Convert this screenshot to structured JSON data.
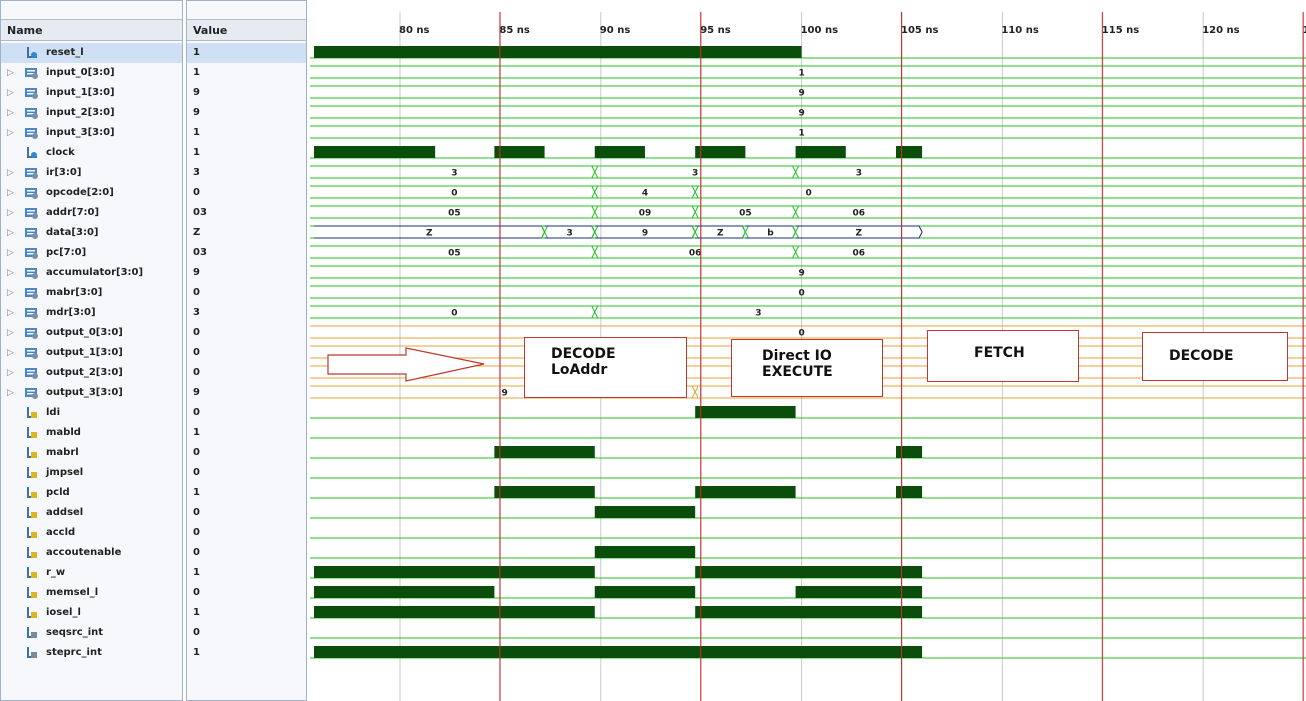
{
  "headers": {
    "name": "Name",
    "value": "Value"
  },
  "time_labels": [
    "80 ns",
    "85 ns",
    "90 ns",
    "95 ns",
    "100 ns",
    "105 ns",
    "110 ns",
    "115 ns",
    "120 ns",
    "1"
  ],
  "colors": {
    "wave": "#22c322",
    "fill": "#0b4d0b",
    "bus_orange": "#e4a33a",
    "cursor": "#d42a2a",
    "grid": "#c9c9c9",
    "bus_outline": "#1b2d7a"
  },
  "signals": [
    {
      "name": "reset_l",
      "value": "1",
      "kind": "bit",
      "icon": "input-pin-icon",
      "selected": true,
      "wave": [
        [
          0,
          4,
          1
        ]
      ]
    },
    {
      "name": "input_0[3:0]",
      "value": "1",
      "kind": "bus",
      "icon": "bus-icon",
      "expandable": true,
      "wave": [
        [
          0,
          4,
          "1"
        ]
      ]
    },
    {
      "name": "input_1[3:0]",
      "value": "9",
      "kind": "bus",
      "icon": "bus-icon",
      "expandable": true,
      "wave": [
        [
          0,
          4,
          "9"
        ]
      ]
    },
    {
      "name": "input_2[3:0]",
      "value": "9",
      "kind": "bus",
      "icon": "bus-icon",
      "expandable": true,
      "wave": [
        [
          0,
          4,
          "9"
        ]
      ]
    },
    {
      "name": "input_3[3:0]",
      "value": "1",
      "kind": "bus",
      "icon": "bus-icon",
      "expandable": true,
      "wave": [
        [
          0,
          4,
          "1"
        ]
      ]
    },
    {
      "name": "clock",
      "value": "1",
      "kind": "bit",
      "icon": "input-pin-icon",
      "wave": [
        [
          0,
          0.35,
          1
        ],
        [
          0.35,
          0.94,
          0
        ],
        [
          0.94,
          1.44,
          1
        ],
        [
          1.44,
          1.94,
          0
        ],
        [
          1.94,
          2.44,
          1
        ],
        [
          2.44,
          2.94,
          0
        ],
        [
          2.94,
          3.44,
          1
        ],
        [
          3.44,
          3.94,
          0
        ],
        [
          3.94,
          4.44,
          1
        ],
        [
          4.44,
          4.94,
          0
        ],
        [
          4.94,
          5.2,
          1
        ]
      ]
    },
    {
      "name": "ir[3:0]",
      "value": "3",
      "kind": "bus",
      "icon": "bus-icon",
      "expandable": true,
      "wave": [
        [
          0,
          1.94,
          "3"
        ],
        [
          1.94,
          3.94,
          "3"
        ],
        [
          3.94,
          5.2,
          "3"
        ]
      ]
    },
    {
      "name": "opcode[2:0]",
      "value": "0",
      "kind": "bus",
      "icon": "bus-icon",
      "expandable": true,
      "wave": [
        [
          0,
          1.94,
          "0"
        ],
        [
          1.94,
          2.94,
          "4"
        ],
        [
          2.94,
          5.2,
          "0"
        ]
      ]
    },
    {
      "name": "addr[7:0]",
      "value": "03",
      "kind": "bus",
      "icon": "bus-icon",
      "expandable": true,
      "wave": [
        [
          0,
          1.94,
          "05"
        ],
        [
          1.94,
          2.94,
          "09"
        ],
        [
          2.94,
          3.94,
          "05"
        ],
        [
          3.94,
          5.2,
          "06"
        ]
      ]
    },
    {
      "name": "data[3:0]",
      "value": "Z",
      "kind": "bus",
      "icon": "bus-icon",
      "expandable": true,
      "outlined": true,
      "wave": [
        [
          0,
          1.44,
          "Z"
        ],
        [
          1.44,
          1.94,
          "3"
        ],
        [
          1.94,
          2.94,
          "9"
        ],
        [
          2.94,
          3.44,
          "Z"
        ],
        [
          3.44,
          3.94,
          "b"
        ],
        [
          3.94,
          5.2,
          "Z"
        ]
      ]
    },
    {
      "name": "pc[7:0]",
      "value": "03",
      "kind": "bus",
      "icon": "bus-icon",
      "expandable": true,
      "wave": [
        [
          0,
          1.94,
          "05"
        ],
        [
          1.94,
          3.94,
          "06"
        ],
        [
          3.94,
          5.2,
          "06"
        ]
      ]
    },
    {
      "name": "accumulator[3:0]",
      "value": "9",
      "kind": "bus",
      "icon": "bus-icon",
      "expandable": true,
      "wave": [
        [
          0,
          4,
          "9"
        ]
      ]
    },
    {
      "name": "mabr[3:0]",
      "value": "0",
      "kind": "bus",
      "icon": "bus-icon",
      "expandable": true,
      "wave": [
        [
          0,
          4,
          "0"
        ]
      ]
    },
    {
      "name": "mdr[3:0]",
      "value": "3",
      "kind": "bus",
      "icon": "bus-icon",
      "expandable": true,
      "wave": [
        [
          0,
          1.94,
          "0"
        ],
        [
          1.94,
          5.2,
          "3"
        ]
      ]
    },
    {
      "name": "output_0[3:0]",
      "value": "0",
      "kind": "bus",
      "icon": "bus-icon",
      "expandable": true,
      "orange": true,
      "wave": [
        [
          0,
          4,
          "0"
        ]
      ]
    },
    {
      "name": "output_1[3:0]",
      "value": "0",
      "kind": "bus",
      "icon": "bus-icon",
      "expandable": true,
      "orange": true,
      "wave": [
        [
          0,
          4,
          "0"
        ]
      ]
    },
    {
      "name": "output_2[3:0]",
      "value": "0",
      "kind": "bus",
      "icon": "bus-icon",
      "expandable": true,
      "orange": true,
      "wave": [
        [
          0,
          4,
          "0"
        ]
      ]
    },
    {
      "name": "output_3[3:0]",
      "value": "9",
      "kind": "bus",
      "icon": "bus-icon",
      "expandable": true,
      "orange": true,
      "wave": [
        [
          0,
          2.94,
          "9"
        ],
        [
          2.94,
          5.2,
          "9"
        ]
      ]
    },
    {
      "name": "ldi",
      "value": "0",
      "kind": "bit",
      "icon": "output-pin-icon",
      "wave": [
        [
          2.94,
          3.94,
          1
        ]
      ]
    },
    {
      "name": "mabld",
      "value": "1",
      "kind": "bit",
      "icon": "output-pin-icon",
      "wave": []
    },
    {
      "name": "mabrl",
      "value": "0",
      "kind": "bit",
      "icon": "output-pin-icon",
      "wave": [
        [
          0.94,
          1.94,
          1
        ],
        [
          4.94,
          5.2,
          1
        ]
      ]
    },
    {
      "name": "jmpsel",
      "value": "0",
      "kind": "bit",
      "icon": "output-pin-icon",
      "wave": []
    },
    {
      "name": "pcld",
      "value": "1",
      "kind": "bit",
      "icon": "output-pin-icon",
      "wave": [
        [
          0.94,
          1.94,
          1
        ],
        [
          2.94,
          3.94,
          1
        ],
        [
          4.94,
          5.2,
          1
        ]
      ]
    },
    {
      "name": "addsel",
      "value": "0",
      "kind": "bit",
      "icon": "output-pin-icon",
      "wave": [
        [
          1.94,
          2.94,
          1
        ]
      ]
    },
    {
      "name": "accld",
      "value": "0",
      "kind": "bit",
      "icon": "output-pin-icon",
      "wave": []
    },
    {
      "name": "accoutenable",
      "value": "0",
      "kind": "bit",
      "icon": "output-pin-icon",
      "wave": [
        [
          1.94,
          2.94,
          1
        ]
      ]
    },
    {
      "name": "r_w",
      "value": "1",
      "kind": "bit",
      "icon": "output-pin-icon",
      "wave": [
        [
          0,
          1.94,
          1
        ],
        [
          2.94,
          5.2,
          1
        ]
      ]
    },
    {
      "name": "memsel_l",
      "value": "0",
      "kind": "bit",
      "icon": "output-pin-icon",
      "wave": [
        [
          0,
          0.94,
          1
        ],
        [
          1.94,
          2.94,
          1
        ],
        [
          3.94,
          5.2,
          1
        ]
      ]
    },
    {
      "name": "iosel_l",
      "value": "1",
      "kind": "bit",
      "icon": "output-pin-icon",
      "wave": [
        [
          0,
          1.94,
          1
        ],
        [
          2.94,
          5.2,
          1
        ]
      ]
    },
    {
      "name": "seqsrc_int",
      "value": "0",
      "kind": "bit",
      "icon": "internal-pin-icon",
      "wave": []
    },
    {
      "name": "steprc_int",
      "value": "1",
      "kind": "bit",
      "icon": "internal-pin-icon",
      "wave": [
        [
          0,
          5.2,
          1
        ]
      ]
    }
  ],
  "annotations": [
    {
      "id": "decode-loaddr",
      "lines": [
        "DECODE",
        "LoAddr"
      ]
    },
    {
      "id": "direct-io-execute",
      "lines": [
        "Direct IO",
        "EXECUTE"
      ]
    },
    {
      "id": "fetch",
      "lines": [
        "FETCH"
      ]
    },
    {
      "id": "decode",
      "lines": [
        "DECODE"
      ]
    }
  ]
}
